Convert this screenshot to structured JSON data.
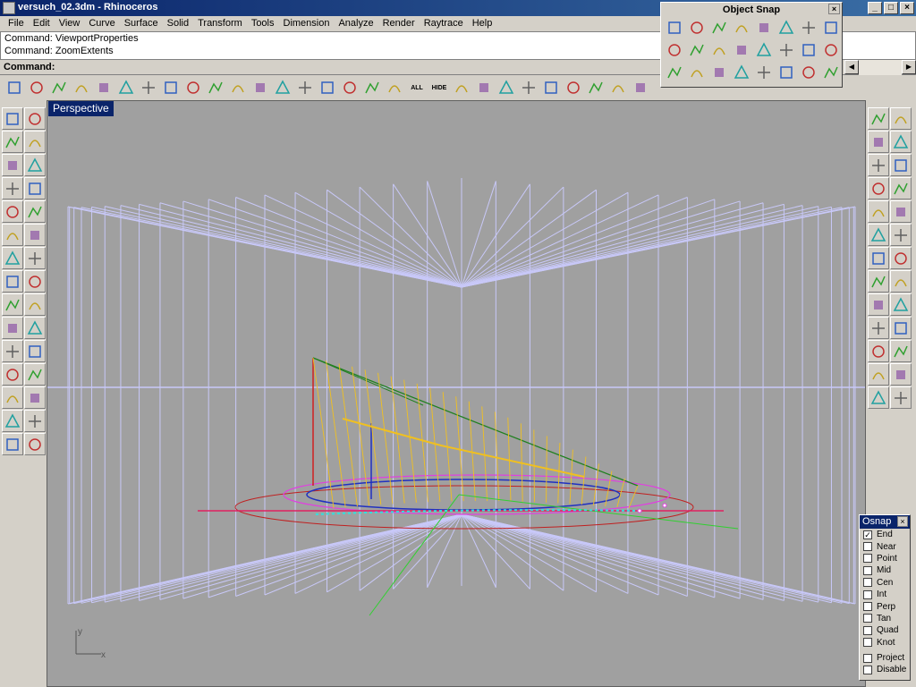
{
  "window": {
    "title": "versuch_02.3dm - Rhinoceros",
    "min": "_",
    "max": "□",
    "close": "×"
  },
  "menu": [
    "File",
    "Edit",
    "View",
    "Curve",
    "Surface",
    "Solid",
    "Transform",
    "Tools",
    "Dimension",
    "Analyze",
    "Render",
    "Raytrace",
    "Help"
  ],
  "command": {
    "history": [
      "Command: ViewportProperties",
      "Command: ZoomExtents"
    ],
    "prompt": "Command:"
  },
  "toolbar": {
    "icons": [
      "new-icon",
      "open-icon",
      "save-icon",
      "cut-icon",
      "copy-icon",
      "paste-icon",
      "undo-icon",
      "pan-icon",
      "rotate-view-icon",
      "zoom-dynamic-icon",
      "zoom-window-icon",
      "zoom-extents-icon",
      "zoom-selected-icon",
      "zoom-previous-icon",
      "four-viewports-icon",
      "car-icon",
      "ghosted-icon",
      "point-on-icon"
    ],
    "all_label": "ALL",
    "hide_label": "HIDE",
    "icons2": [
      "layer-icon",
      "color-wheel-icon",
      "render-sphere-icon",
      "blue-sphere-icon",
      "light-icon",
      "gear-icon",
      "dimension-icon",
      "help-icon",
      "properties-icon"
    ]
  },
  "viewport": {
    "title": "Perspective",
    "axis_y": "y",
    "axis_x": "x"
  },
  "object_snap_toolbar": {
    "title": "Object Snap",
    "close": "×"
  },
  "osnap": {
    "title": "Osnap",
    "close": "×",
    "items": [
      {
        "label": "End",
        "checked": true
      },
      {
        "label": "Near",
        "checked": false
      },
      {
        "label": "Point",
        "checked": false
      },
      {
        "label": "Mid",
        "checked": false
      },
      {
        "label": "Cen",
        "checked": false
      },
      {
        "label": "Int",
        "checked": false
      },
      {
        "label": "Perp",
        "checked": false
      },
      {
        "label": "Tan",
        "checked": false
      },
      {
        "label": "Quad",
        "checked": false
      },
      {
        "label": "Knot",
        "checked": false
      }
    ],
    "extra": [
      {
        "label": "Project",
        "checked": false
      },
      {
        "label": "Disable",
        "checked": false
      }
    ]
  },
  "colors": {
    "title_bar": "#0a246a",
    "viewport_bg": "#a0a0a0",
    "wire": "#c8c8f8"
  }
}
